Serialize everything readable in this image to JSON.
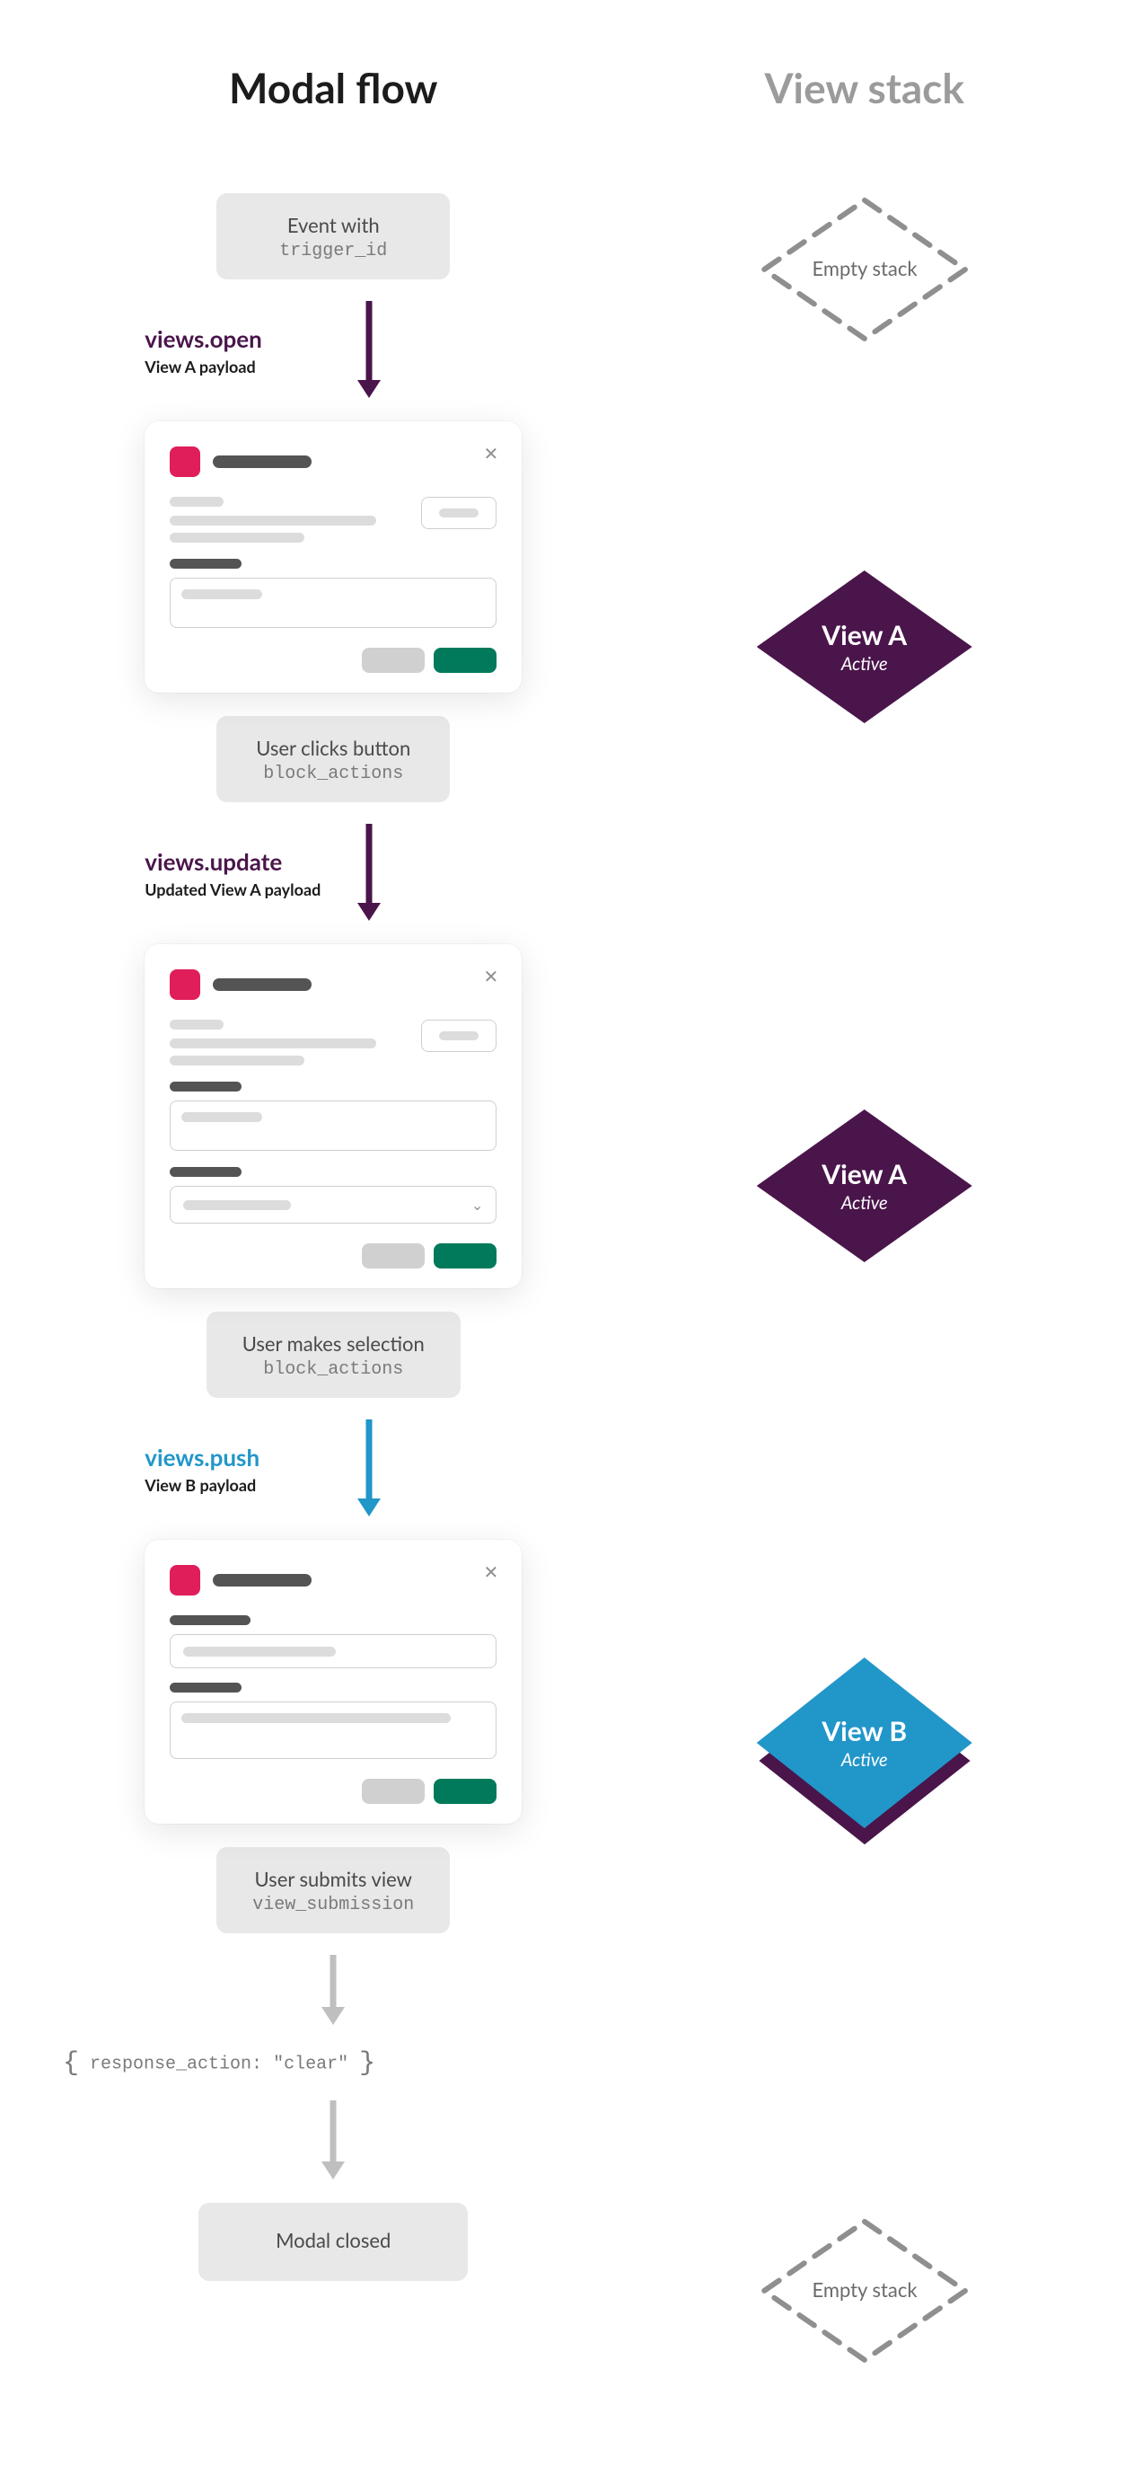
{
  "headings": {
    "left": "Modal flow",
    "right": "View stack"
  },
  "events": {
    "initial": {
      "line1": "Event with",
      "line2": "trigger_id"
    },
    "click": {
      "line1": "User clicks button",
      "line2": "block_actions"
    },
    "select": {
      "line1": "User makes selection",
      "line2": "block_actions"
    },
    "submit": {
      "line1": "User submits view",
      "line2": "view_submission"
    },
    "closed": {
      "line1": "Modal closed"
    }
  },
  "api_calls": {
    "open": {
      "api": "views.open",
      "sub": "View A payload"
    },
    "update": {
      "api": "views.update",
      "sub": "Updated View A payload"
    },
    "push": {
      "api": "views.push",
      "sub": "View B payload"
    }
  },
  "response_action": "response_action: \"clear\"",
  "stack": {
    "empty": "Empty stack",
    "view_a": {
      "title": "View A",
      "status": "Active"
    },
    "view_b": {
      "title": "View B",
      "status": "Active"
    }
  },
  "colors": {
    "purple": "#4a154b",
    "blue": "#2196c9",
    "gray": "#bfbfbf"
  }
}
